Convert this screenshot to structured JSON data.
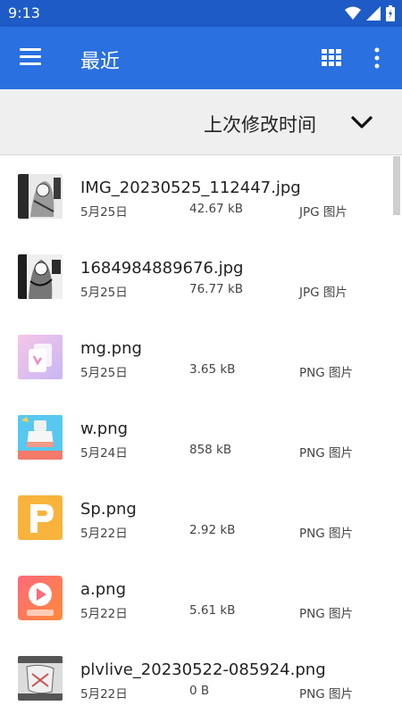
{
  "status": {
    "time": "9:13"
  },
  "appbar": {
    "title": "最近"
  },
  "sort": {
    "label": "上次修改时间"
  },
  "files": [
    {
      "name": "IMG_20230525_112447.jpg",
      "date": "5月25日",
      "size": "42.67 kB",
      "type": "JPG 图片",
      "thumb": "manga-icon"
    },
    {
      "name": "1684984889676.jpg",
      "date": "5月25日",
      "size": "76.77 kB",
      "type": "JPG 图片",
      "thumb": "manga-icon"
    },
    {
      "name": "mg.png",
      "date": "5月25日",
      "size": "3.65 kB",
      "type": "PNG 图片",
      "thumb": "pink-app-icon"
    },
    {
      "name": "w.png",
      "date": "5月24日",
      "size": "858 kB",
      "type": "PNG 图片",
      "thumb": "cleaner-app-icon"
    },
    {
      "name": "Sp.png",
      "date": "5月22日",
      "size": "2.92 kB",
      "type": "PNG 图片",
      "thumb": "p-logo-icon"
    },
    {
      "name": "a.png",
      "date": "5月22日",
      "size": "5.61 kB",
      "type": "PNG 图片",
      "thumb": "play-app-icon"
    },
    {
      "name": "plvlive_20230522-085924.png",
      "date": "5月22日",
      "size": "0 B",
      "type": "PNG 图片",
      "thumb": "sketch-icon"
    }
  ],
  "colors": {
    "statusbar": "#1e5bc6",
    "appbar": "#2a70e0",
    "sortbar": "#efefef"
  }
}
